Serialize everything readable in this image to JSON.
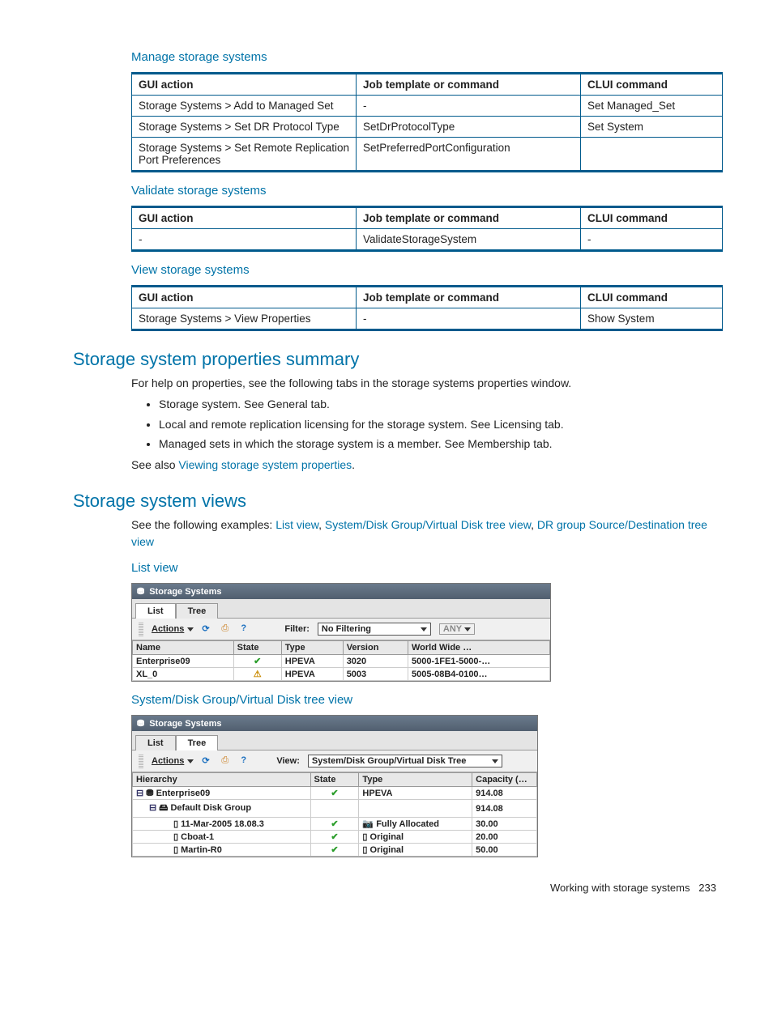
{
  "sections": {
    "manage": {
      "title": "Manage storage systems",
      "headers": [
        "GUI action",
        "Job  template or command",
        "CLUI command"
      ],
      "rows": [
        [
          "Storage Systems > Add to Managed Set",
          "-",
          "Set Managed_Set"
        ],
        [
          "Storage Systems > Set DR Protocol Type",
          "SetDrProtocolType",
          "Set System"
        ],
        [
          "Storage Systems > Set Remote Replication Port Preferences",
          "SetPreferredPortConfiguration",
          ""
        ]
      ]
    },
    "validate": {
      "title": "Validate storage systems",
      "headers": [
        "GUI action",
        "Job  template or command",
        "CLUI command"
      ],
      "rows": [
        [
          "-",
          "ValidateStorageSystem",
          "-"
        ]
      ]
    },
    "view": {
      "title": "View storage systems",
      "headers": [
        "GUI action",
        "Job  template or command",
        "CLUI command"
      ],
      "rows": [
        [
          "Storage Systems > View Properties",
          "-",
          "Show System"
        ]
      ]
    }
  },
  "props_summary": {
    "title": "Storage system properties summary",
    "intro": "For help on properties, see the following tabs in the storage systems properties window.",
    "bullets": [
      "Storage system. See General tab.",
      "Local and remote replication licensing for the storage system. See Licensing tab.",
      "Managed sets in which the storage system is a member. See Membership tab."
    ],
    "see_also_text": "See also ",
    "see_also_link": "Viewing storage system properties"
  },
  "views": {
    "title": "Storage system views",
    "intro_prefix": "See the following examples: ",
    "links": [
      "List view",
      "System/Disk Group/Virtual Disk tree view",
      "DR group Source/Destination tree view"
    ]
  },
  "listview": {
    "heading": "List view",
    "window_title": "Storage Systems",
    "tabs": [
      "List",
      "Tree"
    ],
    "active_tab": "List",
    "actions_label": "Actions",
    "filter_label": "Filter:",
    "filter_value": "No Filtering",
    "any_label": "ANY",
    "columns": [
      "Name",
      "State",
      "Type",
      "Version",
      "World Wide …"
    ],
    "rows": [
      {
        "name": "Enterprise09",
        "state": "ok",
        "type": "HPEVA",
        "version": "3020",
        "ww": "5000-1FE1-5000-…"
      },
      {
        "name": "XL_0",
        "state": "warn",
        "type": "HPEVA",
        "version": "5003",
        "ww": "5005-08B4-0100…"
      }
    ]
  },
  "treeview": {
    "heading": "System/Disk Group/Virtual Disk tree view",
    "window_title": "Storage Systems",
    "tabs": [
      "List",
      "Tree"
    ],
    "active_tab": "Tree",
    "actions_label": "Actions",
    "view_label": "View:",
    "view_value": "System/Disk Group/Virtual Disk Tree",
    "columns": [
      "Hierarchy",
      "State",
      "Type",
      "Capacity (…"
    ],
    "rows": [
      {
        "indent": 0,
        "toggle": "⚪",
        "name": "Enterprise09",
        "state": "ok",
        "type": "HPEVA",
        "cap": "914.08"
      },
      {
        "indent": 1,
        "toggle": "⚪",
        "name": "Default Disk Group",
        "state": "",
        "type": "",
        "cap": "914.08"
      },
      {
        "indent": 2,
        "toggle": "",
        "name": "11-Mar-2005 18.08.3",
        "state": "ok",
        "type": "Fully Allocated",
        "cap": "30.00"
      },
      {
        "indent": 2,
        "toggle": "",
        "name": "Cboat-1",
        "state": "ok",
        "type": "Original",
        "cap": "20.00"
      },
      {
        "indent": 2,
        "toggle": "",
        "name": "Martin-R0",
        "state": "ok",
        "type": "Original",
        "cap": "50.00"
      }
    ]
  },
  "footer": {
    "text": "Working with storage systems",
    "page": "233"
  }
}
